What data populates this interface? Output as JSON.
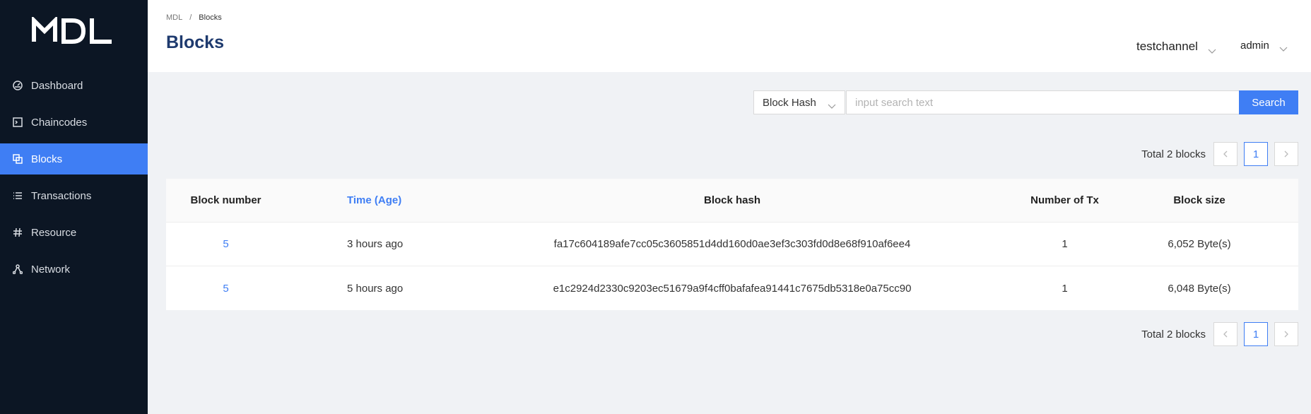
{
  "app": {
    "logo_text": "MDL"
  },
  "sidebar": {
    "items": [
      {
        "label": "Dashboard",
        "icon": "dashboard-icon"
      },
      {
        "label": "Chaincodes",
        "icon": "terminal-icon"
      },
      {
        "label": "Blocks",
        "icon": "blocks-icon",
        "active": true
      },
      {
        "label": "Transactions",
        "icon": "list-icon"
      },
      {
        "label": "Resource",
        "icon": "hash-icon"
      },
      {
        "label": "Network",
        "icon": "network-icon"
      }
    ]
  },
  "header": {
    "breadcrumb": [
      "MDL",
      "/",
      "Blocks"
    ],
    "title": "Blocks",
    "channel": "testchannel",
    "user": "admin"
  },
  "search": {
    "type": "Block Hash",
    "placeholder": "input search text",
    "button": "Search"
  },
  "pagination": {
    "total_text": "Total 2 blocks",
    "current_page": "1"
  },
  "table": {
    "columns": [
      "Block number",
      "Time (Age)",
      "Block hash",
      "Number of Tx",
      "Block size"
    ],
    "rows": [
      [
        "5",
        "3 hours ago",
        "fa17c604189afe7cc05c3605851d4dd160d0ae3ef3c303fd0d8e68f910af6ee4",
        "1",
        "6,052 Byte(s)"
      ],
      [
        "5",
        "5 hours ago",
        "e1c2924d2330c9203ec51679a9f4cff0bafafea91441c7675db5318e0a75cc90",
        "1",
        "6,048 Byte(s)"
      ]
    ]
  },
  "colors": {
    "sidebar_bg": "#0c1624",
    "accent": "#3f7ef4",
    "title": "#1e3a6e"
  }
}
